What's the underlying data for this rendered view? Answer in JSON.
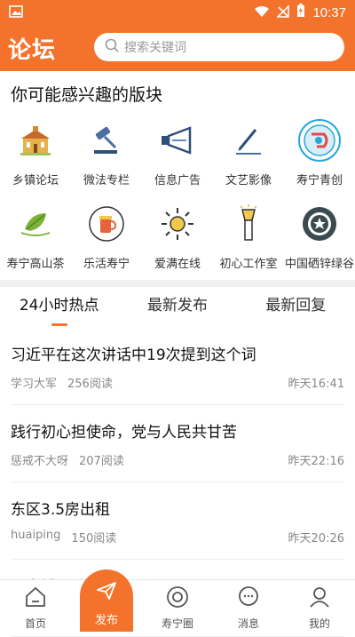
{
  "status_bar": {
    "time": "10:37"
  },
  "header": {
    "title": "论坛"
  },
  "search": {
    "placeholder": "搜索关键词"
  },
  "interest_section": {
    "title": "你可能感兴趣的版块"
  },
  "boards_row1": [
    {
      "label": "乡镇论坛",
      "icon": "town-hall-icon"
    },
    {
      "label": "微法专栏",
      "icon": "gavel-icon"
    },
    {
      "label": "信息广告",
      "icon": "megaphone-icon"
    },
    {
      "label": "文艺影像",
      "icon": "pen-icon"
    },
    {
      "label": "寿宁青创",
      "icon": "youth-badge-icon"
    }
  ],
  "boards_row2": [
    {
      "label": "寿宁高山茶",
      "icon": "tea-leaf-icon"
    },
    {
      "label": "乐活寿宁",
      "icon": "beer-badge-icon"
    },
    {
      "label": "爱满在线",
      "icon": "sun-icon"
    },
    {
      "label": "初心工作室",
      "icon": "flashlight-icon"
    },
    {
      "label": "中国硒锌绿谷",
      "icon": "star-badge-icon"
    }
  ],
  "tabs": [
    {
      "label": "24小时热点",
      "active": true
    },
    {
      "label": "最新发布",
      "active": false
    },
    {
      "label": "最新回复",
      "active": false
    }
  ],
  "posts": [
    {
      "title": "习近平在这次讲话中19次提到这个词",
      "author": "学习大军",
      "reads": "256阅读",
      "time": "昨天16:41"
    },
    {
      "title": "践行初心担使命，党与人民共甘苦",
      "author": "惩戒不大呀",
      "reads": "207阅读",
      "time": "昨天22:16"
    },
    {
      "title": "东区3.5房出租",
      "author": "huaiping",
      "reads": "150阅读",
      "time": "昨天20:26"
    },
    {
      "title": "曙光城运动",
      "author": "",
      "reads": "",
      "time": ""
    }
  ],
  "bottom_nav": [
    {
      "label": "首页",
      "icon": "home-icon"
    },
    {
      "label": "发布",
      "icon": "send-icon"
    },
    {
      "label": "寿宁圈",
      "icon": "circle-icon"
    },
    {
      "label": "消息",
      "icon": "chat-icon"
    },
    {
      "label": "我的",
      "icon": "user-icon"
    }
  ],
  "colors": {
    "accent": "#f4732c"
  }
}
